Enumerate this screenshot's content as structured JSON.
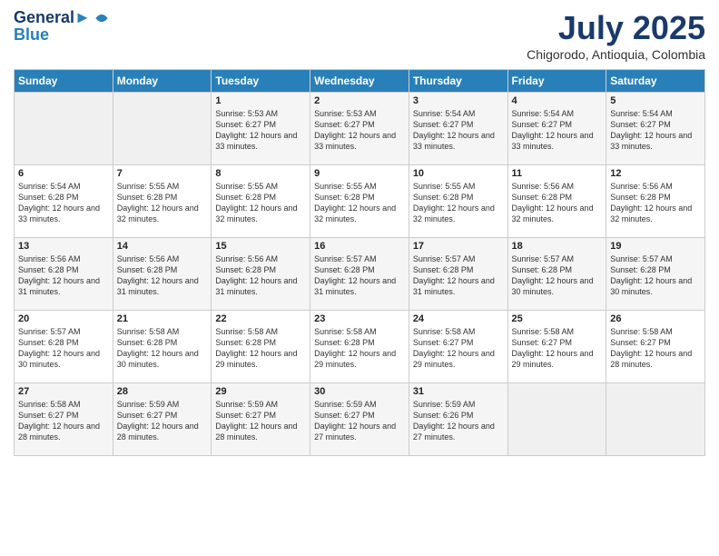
{
  "logo": {
    "line1": "General",
    "line2": "Blue"
  },
  "title": "July 2025",
  "subtitle": "Chigorodo, Antioquia, Colombia",
  "days_of_week": [
    "Sunday",
    "Monday",
    "Tuesday",
    "Wednesday",
    "Thursday",
    "Friday",
    "Saturday"
  ],
  "weeks": [
    [
      {
        "day": "",
        "sunrise": "",
        "sunset": "",
        "daylight": ""
      },
      {
        "day": "",
        "sunrise": "",
        "sunset": "",
        "daylight": ""
      },
      {
        "day": "1",
        "sunrise": "Sunrise: 5:53 AM",
        "sunset": "Sunset: 6:27 PM",
        "daylight": "Daylight: 12 hours and 33 minutes."
      },
      {
        "day": "2",
        "sunrise": "Sunrise: 5:53 AM",
        "sunset": "Sunset: 6:27 PM",
        "daylight": "Daylight: 12 hours and 33 minutes."
      },
      {
        "day": "3",
        "sunrise": "Sunrise: 5:54 AM",
        "sunset": "Sunset: 6:27 PM",
        "daylight": "Daylight: 12 hours and 33 minutes."
      },
      {
        "day": "4",
        "sunrise": "Sunrise: 5:54 AM",
        "sunset": "Sunset: 6:27 PM",
        "daylight": "Daylight: 12 hours and 33 minutes."
      },
      {
        "day": "5",
        "sunrise": "Sunrise: 5:54 AM",
        "sunset": "Sunset: 6:27 PM",
        "daylight": "Daylight: 12 hours and 33 minutes."
      }
    ],
    [
      {
        "day": "6",
        "sunrise": "Sunrise: 5:54 AM",
        "sunset": "Sunset: 6:28 PM",
        "daylight": "Daylight: 12 hours and 33 minutes."
      },
      {
        "day": "7",
        "sunrise": "Sunrise: 5:55 AM",
        "sunset": "Sunset: 6:28 PM",
        "daylight": "Daylight: 12 hours and 32 minutes."
      },
      {
        "day": "8",
        "sunrise": "Sunrise: 5:55 AM",
        "sunset": "Sunset: 6:28 PM",
        "daylight": "Daylight: 12 hours and 32 minutes."
      },
      {
        "day": "9",
        "sunrise": "Sunrise: 5:55 AM",
        "sunset": "Sunset: 6:28 PM",
        "daylight": "Daylight: 12 hours and 32 minutes."
      },
      {
        "day": "10",
        "sunrise": "Sunrise: 5:55 AM",
        "sunset": "Sunset: 6:28 PM",
        "daylight": "Daylight: 12 hours and 32 minutes."
      },
      {
        "day": "11",
        "sunrise": "Sunrise: 5:56 AM",
        "sunset": "Sunset: 6:28 PM",
        "daylight": "Daylight: 12 hours and 32 minutes."
      },
      {
        "day": "12",
        "sunrise": "Sunrise: 5:56 AM",
        "sunset": "Sunset: 6:28 PM",
        "daylight": "Daylight: 12 hours and 32 minutes."
      }
    ],
    [
      {
        "day": "13",
        "sunrise": "Sunrise: 5:56 AM",
        "sunset": "Sunset: 6:28 PM",
        "daylight": "Daylight: 12 hours and 31 minutes."
      },
      {
        "day": "14",
        "sunrise": "Sunrise: 5:56 AM",
        "sunset": "Sunset: 6:28 PM",
        "daylight": "Daylight: 12 hours and 31 minutes."
      },
      {
        "day": "15",
        "sunrise": "Sunrise: 5:56 AM",
        "sunset": "Sunset: 6:28 PM",
        "daylight": "Daylight: 12 hours and 31 minutes."
      },
      {
        "day": "16",
        "sunrise": "Sunrise: 5:57 AM",
        "sunset": "Sunset: 6:28 PM",
        "daylight": "Daylight: 12 hours and 31 minutes."
      },
      {
        "day": "17",
        "sunrise": "Sunrise: 5:57 AM",
        "sunset": "Sunset: 6:28 PM",
        "daylight": "Daylight: 12 hours and 31 minutes."
      },
      {
        "day": "18",
        "sunrise": "Sunrise: 5:57 AM",
        "sunset": "Sunset: 6:28 PM",
        "daylight": "Daylight: 12 hours and 30 minutes."
      },
      {
        "day": "19",
        "sunrise": "Sunrise: 5:57 AM",
        "sunset": "Sunset: 6:28 PM",
        "daylight": "Daylight: 12 hours and 30 minutes."
      }
    ],
    [
      {
        "day": "20",
        "sunrise": "Sunrise: 5:57 AM",
        "sunset": "Sunset: 6:28 PM",
        "daylight": "Daylight: 12 hours and 30 minutes."
      },
      {
        "day": "21",
        "sunrise": "Sunrise: 5:58 AM",
        "sunset": "Sunset: 6:28 PM",
        "daylight": "Daylight: 12 hours and 30 minutes."
      },
      {
        "day": "22",
        "sunrise": "Sunrise: 5:58 AM",
        "sunset": "Sunset: 6:28 PM",
        "daylight": "Daylight: 12 hours and 29 minutes."
      },
      {
        "day": "23",
        "sunrise": "Sunrise: 5:58 AM",
        "sunset": "Sunset: 6:28 PM",
        "daylight": "Daylight: 12 hours and 29 minutes."
      },
      {
        "day": "24",
        "sunrise": "Sunrise: 5:58 AM",
        "sunset": "Sunset: 6:27 PM",
        "daylight": "Daylight: 12 hours and 29 minutes."
      },
      {
        "day": "25",
        "sunrise": "Sunrise: 5:58 AM",
        "sunset": "Sunset: 6:27 PM",
        "daylight": "Daylight: 12 hours and 29 minutes."
      },
      {
        "day": "26",
        "sunrise": "Sunrise: 5:58 AM",
        "sunset": "Sunset: 6:27 PM",
        "daylight": "Daylight: 12 hours and 28 minutes."
      }
    ],
    [
      {
        "day": "27",
        "sunrise": "Sunrise: 5:58 AM",
        "sunset": "Sunset: 6:27 PM",
        "daylight": "Daylight: 12 hours and 28 minutes."
      },
      {
        "day": "28",
        "sunrise": "Sunrise: 5:59 AM",
        "sunset": "Sunset: 6:27 PM",
        "daylight": "Daylight: 12 hours and 28 minutes."
      },
      {
        "day": "29",
        "sunrise": "Sunrise: 5:59 AM",
        "sunset": "Sunset: 6:27 PM",
        "daylight": "Daylight: 12 hours and 28 minutes."
      },
      {
        "day": "30",
        "sunrise": "Sunrise: 5:59 AM",
        "sunset": "Sunset: 6:27 PM",
        "daylight": "Daylight: 12 hours and 27 minutes."
      },
      {
        "day": "31",
        "sunrise": "Sunrise: 5:59 AM",
        "sunset": "Sunset: 6:26 PM",
        "daylight": "Daylight: 12 hours and 27 minutes."
      },
      {
        "day": "",
        "sunrise": "",
        "sunset": "",
        "daylight": ""
      },
      {
        "day": "",
        "sunrise": "",
        "sunset": "",
        "daylight": ""
      }
    ]
  ]
}
